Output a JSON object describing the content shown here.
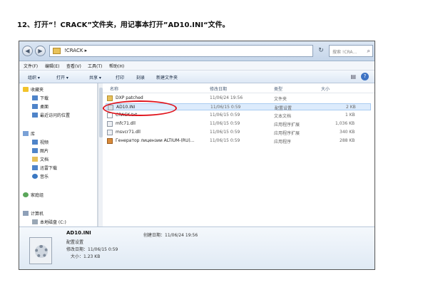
{
  "instruction": "12、打开“！CRACK”文件夹，用记事本打开”AD10.INI“文件。",
  "window": {
    "address": {
      "segments": [
        "!CRACK",
        "▸"
      ],
      "search_placeholder": "搜索 !CRA..."
    },
    "nav": {
      "back": "◀",
      "forward": "▶",
      "refresh": "↻"
    },
    "menubar": [
      "文件(F)",
      "编辑(E)",
      "查看(V)",
      "工具(T)",
      "帮助(H)"
    ],
    "toolbar": [
      "组织 ▾",
      "打开 ▾",
      "共享 ▾",
      "打印",
      "刻录",
      "新建文件夹"
    ],
    "toolbar_help": "?",
    "navpane": {
      "favorites": "收藏夹",
      "favorites_items": [
        "下载",
        "桌面",
        "最近访问的位置"
      ],
      "library": "库",
      "library_items": [
        "视频",
        "图片",
        "文档",
        "迅雷下载",
        "音乐"
      ],
      "homegroup": "家庭组",
      "computer": "计算机",
      "computer_items": [
        "本地磁盘 (C:)"
      ]
    },
    "columns": [
      "名称",
      "修改日期",
      "类型",
      "大小"
    ],
    "files": [
      {
        "name": "DXP patched",
        "date": "11/06/24 19:56",
        "type": "文件夹",
        "size": "",
        "icon": "folder"
      },
      {
        "name": "AD10.INI",
        "date": "11/06/15 0:59",
        "type": "配置设置",
        "size": "2 KB",
        "icon": "ini",
        "selected": true
      },
      {
        "name": "CRACK.txt",
        "date": "11/06/15 0:59",
        "type": "文本文档",
        "size": "1 KB",
        "icon": "txt"
      },
      {
        "name": "mfc71.dll",
        "date": "11/06/15 0:59",
        "type": "应用程序扩展",
        "size": "1,036 KB",
        "icon": "dll"
      },
      {
        "name": "msvcr71.dll",
        "date": "11/06/15 0:59",
        "type": "应用程序扩展",
        "size": "340 KB",
        "icon": "dll"
      },
      {
        "name": "Генератор лицензии ALTIUM-(RU)...",
        "date": "11/06/15 0:59",
        "type": "应用程序",
        "size": "288 KB",
        "icon": "exe"
      }
    ],
    "details": {
      "filename": "AD10.INI",
      "type": "配置设置",
      "modified_label": "修改日期：",
      "modified": "11/06/15 0:59",
      "size_label": "大小：",
      "size": "1.23 KB",
      "created_label": "创建日期：",
      "created": "11/06/24 19:56"
    },
    "accent": "#e0141c"
  }
}
